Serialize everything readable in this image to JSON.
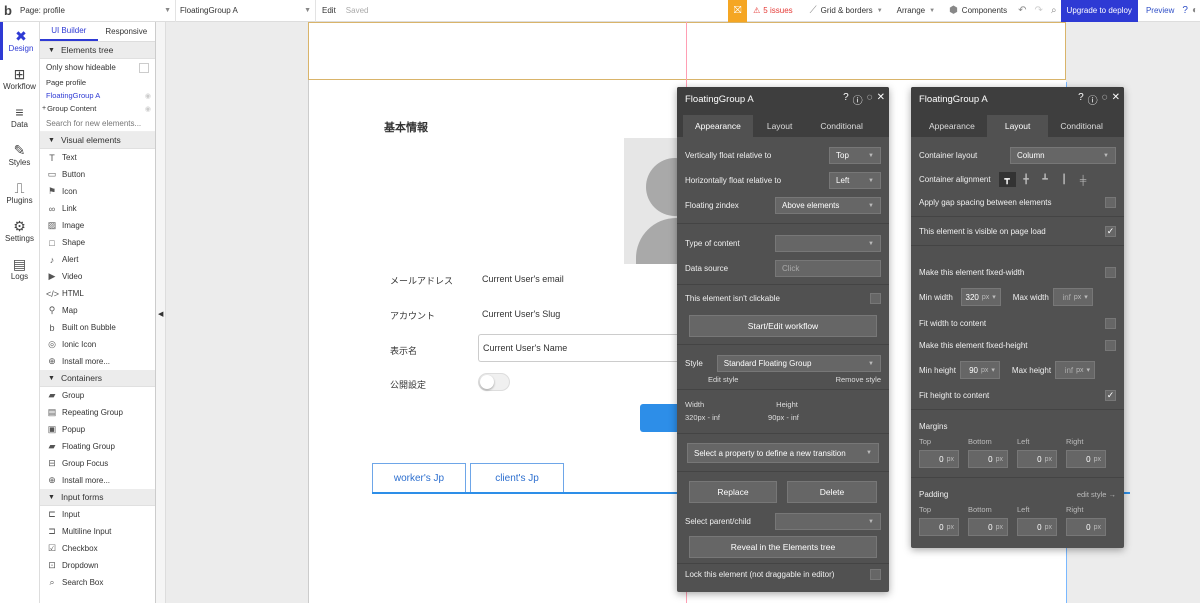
{
  "topbar": {
    "logo": "b",
    "page_select": "Page: profile",
    "element_select": "FloatingGroup A",
    "edit": "Edit",
    "saved": "Saved",
    "warning_icon": "gift-icon",
    "issues": "5 issues",
    "grid": "Grid & borders",
    "arrange": "Arrange",
    "components": "Components",
    "upgrade": "Upgrade to deploy",
    "preview": "Preview",
    "help": "?"
  },
  "rail": {
    "items": [
      {
        "label": "Design",
        "icon": "design-icon"
      },
      {
        "label": "Workflow",
        "icon": "workflow-icon"
      },
      {
        "label": "Data",
        "icon": "data-icon"
      },
      {
        "label": "Styles",
        "icon": "styles-icon"
      },
      {
        "label": "Plugins",
        "icon": "plugins-icon"
      },
      {
        "label": "Settings",
        "icon": "settings-icon"
      },
      {
        "label": "Logs",
        "icon": "logs-icon"
      }
    ]
  },
  "panel": {
    "tabs": [
      "UI Builder",
      "Responsive"
    ],
    "elements_tree": "Elements tree",
    "only_hideable": "Only show hideable",
    "tree": [
      "Page profile",
      "FloatingGroup A",
      "Group Content"
    ],
    "search_placeholder": "Search for new elements...",
    "visual_head": "Visual elements",
    "visual": [
      "Text",
      "Button",
      "Icon",
      "Link",
      "Image",
      "Shape",
      "Alert",
      "Video",
      "HTML",
      "Map",
      "Built on Bubble",
      "Ionic Icon",
      "Install more..."
    ],
    "containers_head": "Containers",
    "containers": [
      "Group",
      "Repeating Group",
      "Popup",
      "Floating Group",
      "Group Focus",
      "Install more..."
    ],
    "inputs_head": "Input forms",
    "inputs": [
      "Input",
      "Multiline Input",
      "Checkbox",
      "Dropdown",
      "Search Box"
    ]
  },
  "canvas": {
    "section_title": "基本情報",
    "fields": [
      {
        "label": "メールアドレス",
        "value": "Current User's email"
      },
      {
        "label": "アカウント",
        "value": "Current User's Slug"
      },
      {
        "label": "表示名",
        "value": "Current User's Name"
      },
      {
        "label": "公開設定",
        "value": ""
      }
    ],
    "tabs": [
      "worker's Jp",
      "client's Jp"
    ]
  },
  "editor1": {
    "title": "FloatingGroup A",
    "tabs": [
      "Appearance",
      "Layout",
      "Conditional"
    ],
    "vfloat_label": "Vertically float relative to",
    "vfloat_value": "Top",
    "hfloat_label": "Horizontally float relative to",
    "hfloat_value": "Left",
    "zindex_label": "Floating zindex",
    "zindex_value": "Above elements",
    "content_label": "Type of content",
    "datasource_label": "Data source",
    "datasource_value": "Click",
    "not_clickable": "This element isn't clickable",
    "workflow_btn": "Start/Edit workflow",
    "style_label": "Style",
    "style_value": "Standard Floating Group",
    "edit_style": "Edit style",
    "remove_style": "Remove style",
    "width_label": "Width",
    "width_value": "320px - inf",
    "height_label": "Height",
    "height_value": "90px - inf",
    "transition": "Select a property to define a new transition",
    "replace": "Replace",
    "delete": "Delete",
    "parent_label": "Select parent/child",
    "reveal": "Reveal in the Elements tree",
    "lock": "Lock this element (not draggable in editor)"
  },
  "editor2": {
    "title": "FloatingGroup A",
    "tabs": [
      "Appearance",
      "Layout",
      "Conditional"
    ],
    "layout_label": "Container layout",
    "layout_value": "Column",
    "align_label": "Container alignment",
    "gap_label": "Apply gap spacing between elements",
    "visible_label": "This element is visible on page load",
    "fixed_width": "Make this element fixed-width",
    "min_width_label": "Min width",
    "min_width": "320",
    "max_width_label": "Max width",
    "max_width": "inf",
    "fit_width": "Fit width to content",
    "fixed_height": "Make this element fixed-height",
    "min_height_label": "Min height",
    "min_height": "90",
    "max_height_label": "Max height",
    "max_height": "inf",
    "fit_height": "Fit height to content",
    "margins": "Margins",
    "sides": [
      "Top",
      "Bottom",
      "Left",
      "Right"
    ],
    "margin_values": [
      "0",
      "0",
      "0",
      "0"
    ],
    "padding": "Padding",
    "edit_style": "edit style →",
    "padding_values": [
      "0",
      "0",
      "0",
      "0"
    ],
    "unit": "px"
  }
}
